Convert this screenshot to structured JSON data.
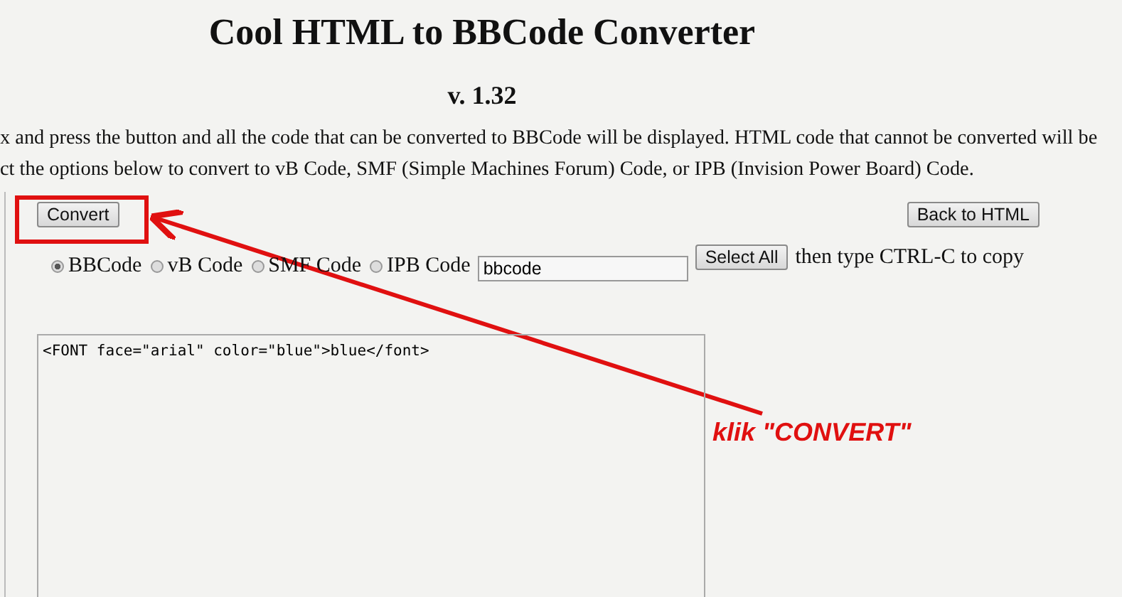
{
  "title": "Cool HTML to BBCode Converter",
  "version": "v. 1.32",
  "instructions": [
    "x and press the button and all the code that can be converted to BBCode will be displayed. HTML code that cannot be converted will be",
    "ct the options below to convert to vB Code, SMF (Simple Machines Forum) Code, or IPB (Invision Power Board) Code."
  ],
  "convert_button": "Convert",
  "back_button": "Back to HTML",
  "formats": [
    {
      "label": "BBCode",
      "selected": true
    },
    {
      "label": "vB Code",
      "selected": false
    },
    {
      "label": "SMF Code",
      "selected": false
    },
    {
      "label": "IPB Code",
      "selected": false
    }
  ],
  "format_field": {
    "value": "bbcode"
  },
  "select_all_button": "Select All",
  "copy_hint": "then type CTRL-C to copy",
  "code_area": {
    "value": "<FONT face=\"arial\" color=\"blue\">blue</font>"
  },
  "annotation": {
    "text": "klik \"CONVERT\""
  }
}
